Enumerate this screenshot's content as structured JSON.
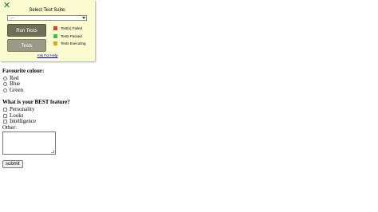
{
  "form": {
    "colour_question": "Favourite colour:",
    "colour_options": [
      "Red",
      "Blue",
      "Green"
    ],
    "feature_question": "What is your BEST feature?",
    "feature_options": [
      "Personality",
      "Looks",
      "Intelligence"
    ],
    "other_label": "Other:",
    "submit_label": "submit"
  },
  "test_panel": {
    "close_icon": "close-icon",
    "title": "Select Test Suite:",
    "suite_select_value": "----",
    "run_label": "Run Tests",
    "tests_label": "Tests",
    "legend": [
      {
        "label": "Test(s) Failed",
        "color": "#e53b2c"
      },
      {
        "label": "Tests Passed",
        "color": "#3cc63c"
      },
      {
        "label": "Tests Executing",
        "color": "#f0a020"
      }
    ],
    "help_link": "Ask For Help"
  },
  "colors": {
    "panel_bg": "#fbfbd0",
    "run_button": "#6e6e5a",
    "tests_button": "#9a9a86",
    "close_icon": "#1a7a1a"
  }
}
